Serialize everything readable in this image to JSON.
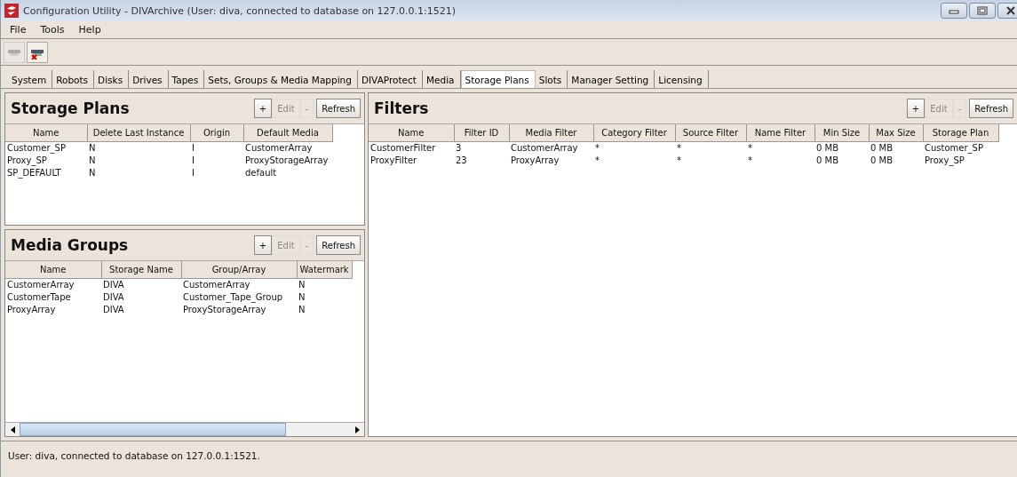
{
  "window": {
    "title": "Configuration Utility - DIVArchive (User: diva, connected to database on 127.0.0.1:1521)"
  },
  "menu": [
    "File",
    "Tools",
    "Help"
  ],
  "toolbar": [
    {
      "kind": "connect",
      "disabled": true
    },
    {
      "kind": "disconnect",
      "disabled": false
    }
  ],
  "tabs": [
    {
      "label": "System",
      "selected": false
    },
    {
      "label": "Robots",
      "selected": false
    },
    {
      "label": "Disks",
      "selected": false
    },
    {
      "label": "Drives",
      "selected": false
    },
    {
      "label": "Tapes",
      "selected": false
    },
    {
      "label": "Sets, Groups & Media Mapping",
      "selected": false
    },
    {
      "label": "DIVAProtect",
      "selected": false
    },
    {
      "label": "Media",
      "selected": false
    },
    {
      "label": "Storage Plans",
      "selected": true
    },
    {
      "label": "Slots",
      "selected": false
    },
    {
      "label": "Manager Setting",
      "selected": false
    },
    {
      "label": "Licensing",
      "selected": false
    }
  ],
  "panels": [
    {
      "title": "Storage Plans",
      "buttons": [
        {
          "label": "+",
          "disabled": false
        },
        {
          "label": "Edit",
          "disabled": true
        },
        {
          "label": "-",
          "disabled": true
        },
        {
          "label": "Refresh",
          "disabled": false
        }
      ],
      "columns": [
        "Name",
        "Delete Last Instance",
        "Origin",
        "Default Media"
      ],
      "rows": [
        [
          "Customer_SP",
          "N",
          "I",
          "CustomerArray"
        ],
        [
          "Proxy_SP",
          "N",
          "I",
          "ProxyStorageArray"
        ],
        [
          "SP_DEFAULT",
          "N",
          "I",
          "default"
        ]
      ]
    },
    {
      "title": "Media Groups",
      "buttons": [
        {
          "label": "+",
          "disabled": false
        },
        {
          "label": "Edit",
          "disabled": true
        },
        {
          "label": "-",
          "disabled": true
        },
        {
          "label": "Refresh",
          "disabled": false
        }
      ],
      "columns": [
        "Name",
        "Storage Name",
        "Group/Array",
        "Watermark"
      ],
      "rows": [
        [
          "CustomerArray",
          "DIVA",
          "CustomerArray",
          "N"
        ],
        [
          "CustomerTape",
          "DIVA",
          "Customer_Tape_Group",
          "N"
        ],
        [
          "ProxyArray",
          "DIVA",
          "ProxyStorageArray",
          "N"
        ]
      ]
    },
    {
      "title": "Filters",
      "buttons": [
        {
          "label": "+",
          "disabled": false
        },
        {
          "label": "Edit",
          "disabled": true
        },
        {
          "label": "-",
          "disabled": true
        },
        {
          "label": "Refresh",
          "disabled": false
        }
      ],
      "columns": [
        "Name",
        "Filter ID",
        "Media Filter",
        "Category Filter",
        "Source Filter",
        "Name Filter",
        "Min Size",
        "Max Size",
        "Storage Plan"
      ],
      "rows": [
        [
          "CustomerFilter",
          "3",
          "CustomerArray",
          "*",
          "*",
          "*",
          "0 MB",
          "0 MB",
          "Customer_SP"
        ],
        [
          "ProxyFilter",
          "23",
          "ProxyArray",
          "*",
          "*",
          "*",
          "0 MB",
          "0 MB",
          "Proxy_SP"
        ]
      ]
    }
  ],
  "status_bar": "User: diva, connected to database on 127.0.0.1:1521."
}
